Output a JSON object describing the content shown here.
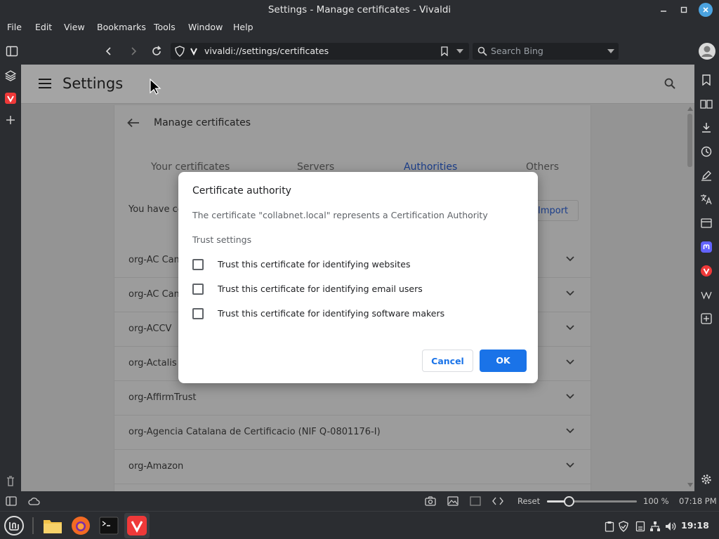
{
  "window": {
    "title": "Settings - Manage certificates - Vivaldi"
  },
  "menubar": {
    "items": [
      "File",
      "Edit",
      "View",
      "Bookmarks",
      "Tools",
      "Window",
      "Help"
    ]
  },
  "address_bar": {
    "url": "vivaldi://settings/certificates"
  },
  "search_bar": {
    "placeholder": "Search Bing"
  },
  "settings": {
    "title": "Settings"
  },
  "certificates": {
    "page_title": "Manage certificates",
    "tabs": [
      "Your certificates",
      "Servers",
      "Authorities",
      "Others"
    ],
    "active_tab": "Authorities",
    "info_text": "You have ce",
    "import_label": "Import",
    "rows": [
      "org-AC Came",
      "org-AC Came",
      "org-ACCV",
      "org-Actalis S",
      "org-AffirmTrust",
      "org-Agencia Catalana de Certificacio (NIF Q-0801176-I)",
      "org-Amazon"
    ]
  },
  "dialog": {
    "title": "Certificate authority",
    "description": "The certificate \"collabnet.local\" represents a Certification Authority",
    "trust_heading": "Trust settings",
    "options": [
      "Trust this certificate for identifying websites",
      "Trust this certificate for identifying email users",
      "Trust this certificate for identifying software makers"
    ],
    "cancel_label": "Cancel",
    "ok_label": "OK"
  },
  "statusbar": {
    "reset_label": "Reset",
    "zoom": "100 %",
    "time": "07:18 PM",
    "zoom_fraction": 0.24
  },
  "taskbar": {
    "clock": "19:18"
  },
  "colors": {
    "accent": "#1a73e8",
    "vivaldi_red": "#ef3939",
    "mastodon": "#6364ff"
  }
}
